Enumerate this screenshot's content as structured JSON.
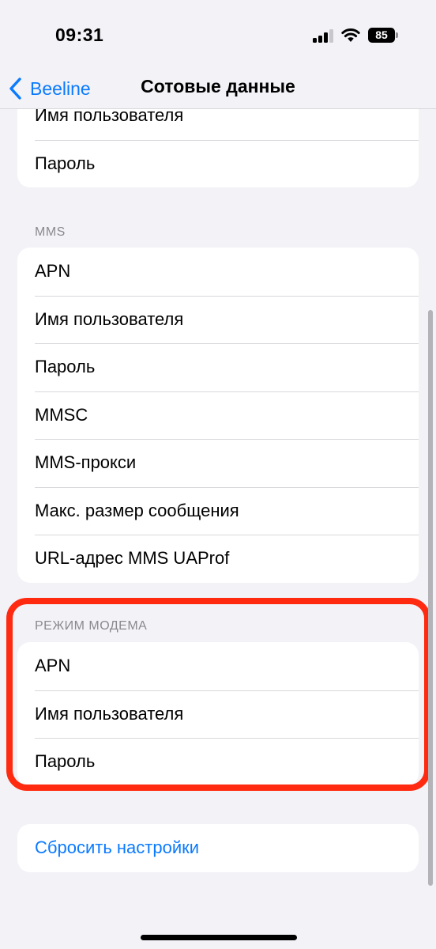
{
  "status_bar": {
    "time": "09:31",
    "battery": "85",
    "icons": [
      "signal-icon",
      "wifi-icon",
      "battery-icon"
    ]
  },
  "nav": {
    "back_label": "Beeline",
    "title": "Сотовые данные"
  },
  "top_group": {
    "items": [
      "Имя пользователя",
      "Пароль"
    ]
  },
  "mms": {
    "header": "MMS",
    "items": [
      "APN",
      "Имя пользователя",
      "Пароль",
      "MMSC",
      "MMS-прокси",
      "Макс. размер сообщения",
      "URL-адрес MMS UAProf"
    ]
  },
  "modem": {
    "header": "РЕЖИМ МОДЕМА",
    "items": [
      "APN",
      "Имя пользователя",
      "Пароль"
    ]
  },
  "reset": {
    "label": "Сбросить настройки"
  },
  "colors": {
    "accent": "#0a7aff",
    "highlight": "#ff2a0f",
    "background": "#f2f2f7"
  }
}
